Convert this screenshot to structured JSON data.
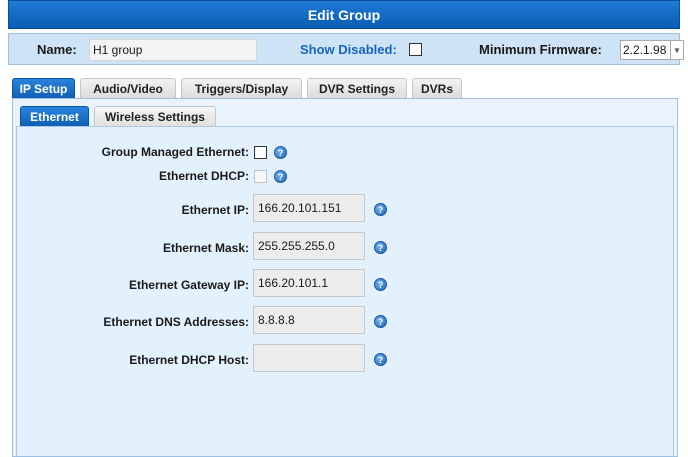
{
  "window": {
    "title": "Edit Group"
  },
  "topbar": {
    "name_label": "Name:",
    "name_value": "H1 group",
    "show_disabled_label": "Show Disabled:",
    "show_disabled_checked": false,
    "min_firmware_label": "Minimum Firmware:",
    "min_firmware_value": "2.2.1.98"
  },
  "tabs": [
    {
      "label": "IP Setup",
      "active": true
    },
    {
      "label": "Audio/Video",
      "active": false
    },
    {
      "label": "Triggers/Display",
      "active": false
    },
    {
      "label": "DVR Settings",
      "active": false
    },
    {
      "label": "DVRs",
      "active": false
    }
  ],
  "subtabs": [
    {
      "label": "Ethernet",
      "active": true
    },
    {
      "label": "Wireless Settings",
      "active": false
    }
  ],
  "ethernet": {
    "group_managed_label": "Group Managed Ethernet:",
    "group_managed_checked": false,
    "dhcp_label": "Ethernet DHCP:",
    "dhcp_checked": false,
    "ip_label": "Ethernet IP:",
    "ip_value": "166.20.101.151",
    "mask_label": "Ethernet Mask:",
    "mask_value": "255.255.255.0",
    "gateway_label": "Ethernet Gateway IP:",
    "gateway_value": "166.20.101.1",
    "dns_label": "Ethernet DNS Addresses:",
    "dns_value": "8.8.8.8",
    "dhcp_host_label": "Ethernet DHCP Host:",
    "dhcp_host_value": ""
  },
  "icons": {
    "help": "help-icon",
    "dropdown": "chevron-down-icon"
  },
  "colors": {
    "accent": "#0f5fb5",
    "panel_bg": "#e3f1fd",
    "link": "#1565c0"
  }
}
